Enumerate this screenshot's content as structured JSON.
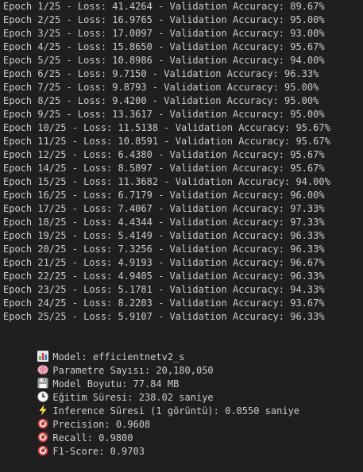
{
  "epochs": [
    "Epoch 1/25 - Loss: 41.4264 - Validation Accuracy: 89.67%",
    "Epoch 2/25 - Loss: 16.9765 - Validation Accuracy: 95.00%",
    "Epoch 3/25 - Loss: 17.0097 - Validation Accuracy: 93.00%",
    "Epoch 4/25 - Loss: 15.8650 - Validation Accuracy: 95.67%",
    "Epoch 5/25 - Loss: 10.8986 - Validation Accuracy: 94.00%",
    "Epoch 6/25 - Loss: 9.7150 - Validation Accuracy: 96.33%",
    "Epoch 7/25 - Loss: 9.8793 - Validation Accuracy: 95.00%",
    "Epoch 8/25 - Loss: 9.4200 - Validation Accuracy: 95.00%",
    "Epoch 9/25 - Loss: 13.3617 - Validation Accuracy: 95.00%",
    "Epoch 10/25 - Loss: 11.5138 - Validation Accuracy: 95.67%",
    "Epoch 11/25 - Loss: 10.8591 - Validation Accuracy: 95.67%",
    "Epoch 12/25 - Loss: 6.4380 - Validation Accuracy: 95.67%",
    "Epoch 14/25 - Loss: 8.5897 - Validation Accuracy: 95.67%",
    "Epoch 15/25 - Loss: 11.3682 - Validation Accuracy: 94.00%",
    "Epoch 16/25 - Loss: 6.7179 - Validation Accuracy: 96.00%",
    "Epoch 17/25 - Loss: 7.4067 - Validation Accuracy: 97.33%",
    "Epoch 18/25 - Loss: 4.4344 - Validation Accuracy: 97.33%",
    "Epoch 19/25 - Loss: 5.4149 - Validation Accuracy: 96.33%",
    "Epoch 20/25 - Loss: 7.3256 - Validation Accuracy: 96.33%",
    "Epoch 21/25 - Loss: 4.9193 - Validation Accuracy: 96.67%",
    "Epoch 22/25 - Loss: 4.9405 - Validation Accuracy: 96.33%",
    "Epoch 23/25 - Loss: 5.1781 - Validation Accuracy: 94.33%",
    "Epoch 24/25 - Loss: 8.2203 - Validation Accuracy: 93.67%",
    "Epoch 25/25 - Loss: 5.9107 - Validation Accuracy: 96.33%"
  ],
  "summary": [
    {
      "icon": "bar-chart-icon",
      "text": "Model: efficientnetv2_s"
    },
    {
      "icon": "brain-icon",
      "text": "Parametre Sayısı: 20,180,050"
    },
    {
      "icon": "floppy-disk-icon",
      "text": "Model Boyutu: 77.84 MB"
    },
    {
      "icon": "clock-icon",
      "text": "Eğitim Süresi: 238.02 saniye"
    },
    {
      "icon": "lightning-icon",
      "text": "Inference Süresi (1 görüntü): 0.0550 saniye"
    },
    {
      "icon": "target-icon",
      "text": "Precision: 0.9608"
    },
    {
      "icon": "target-icon",
      "text": "Recall: 0.9800"
    },
    {
      "icon": "target-icon",
      "text": "F1-Score: 0.9703"
    }
  ]
}
